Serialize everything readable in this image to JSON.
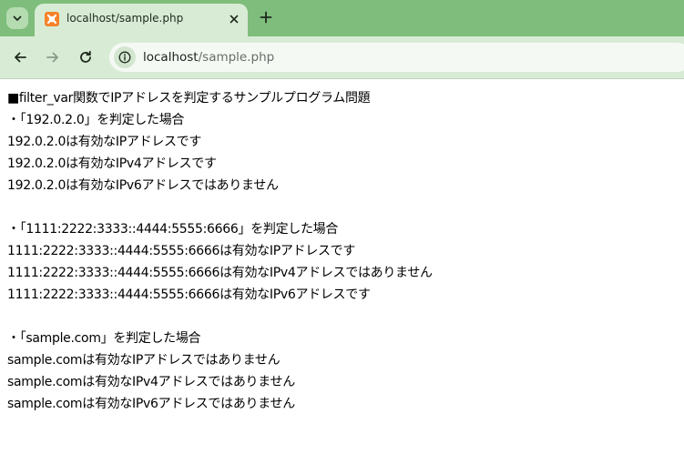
{
  "browser": {
    "tab_title": "localhost/sample.php",
    "new_tab_symbol": "+",
    "url_host": "localhost",
    "url_path": "/sample.php",
    "icons": {
      "tab_search": "chevron-down-icon",
      "favicon": "xampp-favicon-icon",
      "close": "close-icon",
      "back": "back-arrow-icon",
      "forward": "forward-arrow-icon",
      "reload": "reload-icon",
      "site_info": "info-icon"
    },
    "colors": {
      "tabstrip": "#7ebd7b",
      "toolbar": "#d8ecd5",
      "favicon": "#f5832a"
    }
  },
  "page": {
    "lines": [
      "■filter_var関数でIPアドレスを判定するサンプルプログラム問題",
      "・「192.0.2.0」を判定した場合",
      "192.0.2.0は有効なIPアドレスです",
      "192.0.2.0は有効なIPv4アドレスです",
      "192.0.2.0は有効なIPv6アドレスではありません",
      "",
      "・「1111:2222:3333::4444:5555:6666」を判定した場合",
      "1111:2222:3333::4444:5555:6666は有効なIPアドレスです",
      "1111:2222:3333::4444:5555:6666は有効なIPv4アドレスではありません",
      "1111:2222:3333::4444:5555:6666は有効なIPv6アドレスです",
      "",
      "・「sample.com」を判定した場合",
      "sample.comは有効なIPアドレスではありません",
      "sample.comは有効なIPv4アドレスではありません",
      "sample.comは有効なIPv6アドレスではありません"
    ]
  }
}
